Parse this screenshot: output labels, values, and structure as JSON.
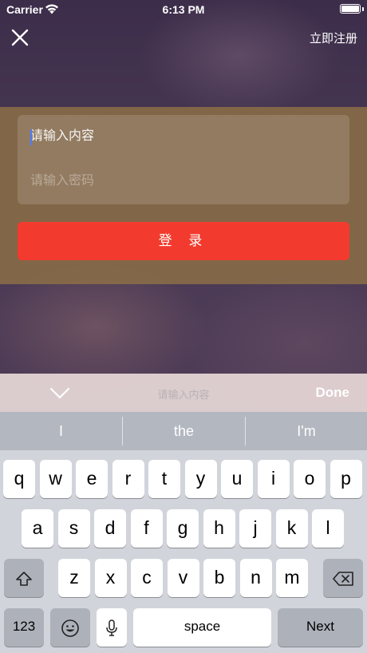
{
  "status_bar": {
    "carrier": "Carrier",
    "time": "6:13 PM"
  },
  "nav": {
    "register_label": "立即注册",
    "close_icon": "close-icon"
  },
  "login": {
    "username_placeholder": "请输入内容",
    "password_placeholder": "请输入密码",
    "login_label": "登 录",
    "button_color": "#f23b2e"
  },
  "keyboard_accessory": {
    "placeholder": "请输入内容",
    "done_label": "Done"
  },
  "suggestions": [
    "I",
    "the",
    "I'm"
  ],
  "keyboard": {
    "row1": [
      "q",
      "w",
      "e",
      "r",
      "t",
      "y",
      "u",
      "i",
      "o",
      "p"
    ],
    "row2": [
      "a",
      "s",
      "d",
      "f",
      "g",
      "h",
      "j",
      "k",
      "l"
    ],
    "row3": [
      "z",
      "x",
      "c",
      "v",
      "b",
      "n",
      "m"
    ],
    "numbers_label": "123",
    "space_label": "space",
    "next_label": "Next"
  }
}
